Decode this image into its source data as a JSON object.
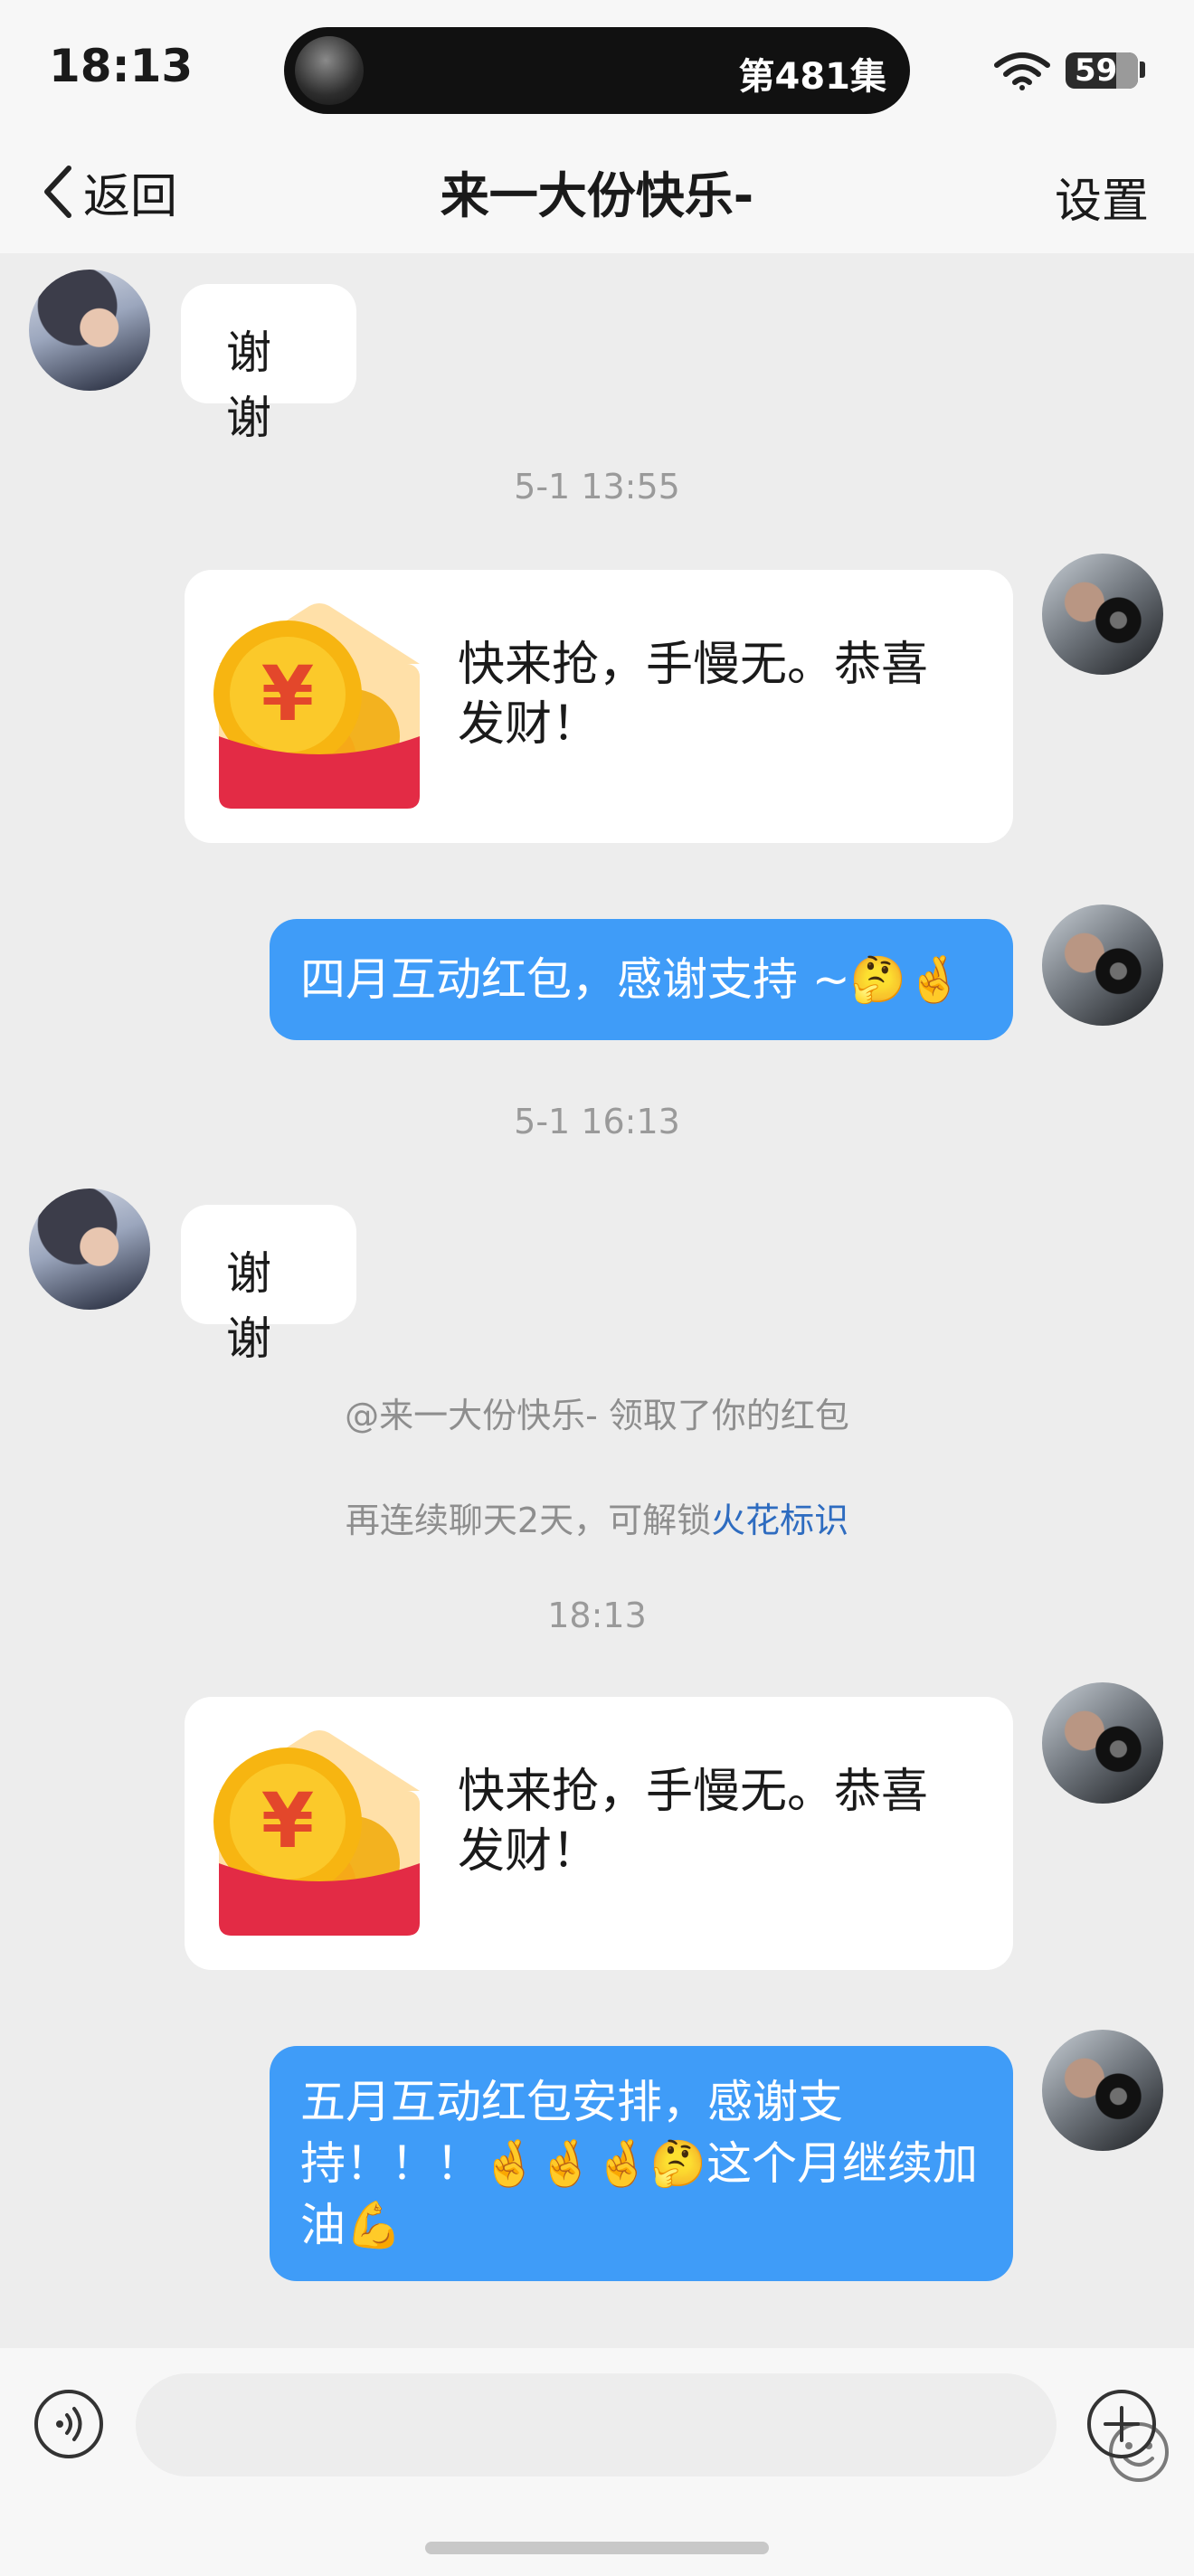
{
  "status_bar": {
    "time": "18:13",
    "live_activity": "第481集",
    "battery_level": "59"
  },
  "nav": {
    "back_label": "返回",
    "title": "来一大份快乐-",
    "settings_label": "设置"
  },
  "messages": [
    {
      "text": "谢谢"
    },
    {
      "timestamp": "5-1 13:55"
    },
    {
      "redpacket_text": "快来抢，手慢无。恭喜发财！"
    },
    {
      "text": "四月互动红包，感谢支持 ~🤔🤞"
    },
    {
      "timestamp": "5-1 16:13"
    },
    {
      "text": "谢谢"
    },
    {
      "system": "@来一大份快乐- 领取了你的红包"
    },
    {
      "system_prefix": "再连续聊天2天，可解锁",
      "system_link": "火花标识"
    },
    {
      "timestamp": "18:13"
    },
    {
      "redpacket_text": "快来抢，手慢无。恭喜发财！"
    },
    {
      "text": "五月互动红包安排，感谢支持！！！🤞🤞🤞🤔这个月继续加油💪"
    }
  ],
  "colors": {
    "outgoing_bubble": "#3f9cf8",
    "red_packet": "#e32b45",
    "link": "#2e6cc0"
  },
  "icons": [
    "back-chevron-icon",
    "wifi-icon",
    "battery-icon",
    "voice-icon",
    "emoji-icon",
    "plus-icon",
    "red-packet-icon"
  ]
}
